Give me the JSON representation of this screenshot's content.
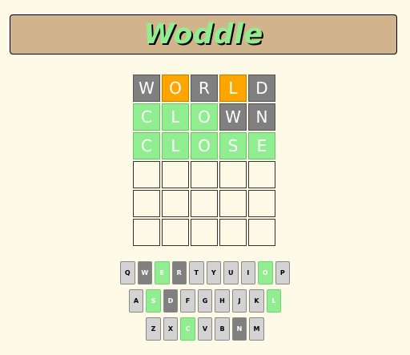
{
  "header": {
    "title": "Woddle"
  },
  "board": {
    "rows": [
      [
        {
          "letter": "W",
          "state": "absent"
        },
        {
          "letter": "O",
          "state": "present"
        },
        {
          "letter": "R",
          "state": "absent"
        },
        {
          "letter": "L",
          "state": "present"
        },
        {
          "letter": "D",
          "state": "absent"
        }
      ],
      [
        {
          "letter": "C",
          "state": "correct"
        },
        {
          "letter": "L",
          "state": "correct"
        },
        {
          "letter": "O",
          "state": "correct"
        },
        {
          "letter": "W",
          "state": "absent"
        },
        {
          "letter": "N",
          "state": "absent"
        }
      ],
      [
        {
          "letter": "C",
          "state": "correct"
        },
        {
          "letter": "L",
          "state": "correct"
        },
        {
          "letter": "O",
          "state": "correct"
        },
        {
          "letter": "S",
          "state": "correct"
        },
        {
          "letter": "E",
          "state": "correct"
        }
      ],
      [
        {
          "letter": "",
          "state": "empty"
        },
        {
          "letter": "",
          "state": "empty"
        },
        {
          "letter": "",
          "state": "empty"
        },
        {
          "letter": "",
          "state": "empty"
        },
        {
          "letter": "",
          "state": "empty"
        }
      ],
      [
        {
          "letter": "",
          "state": "empty"
        },
        {
          "letter": "",
          "state": "empty"
        },
        {
          "letter": "",
          "state": "empty"
        },
        {
          "letter": "",
          "state": "empty"
        },
        {
          "letter": "",
          "state": "empty"
        }
      ],
      [
        {
          "letter": "",
          "state": "empty"
        },
        {
          "letter": "",
          "state": "empty"
        },
        {
          "letter": "",
          "state": "empty"
        },
        {
          "letter": "",
          "state": "empty"
        },
        {
          "letter": "",
          "state": "empty"
        }
      ]
    ]
  },
  "keyboard": {
    "rows": [
      [
        {
          "key": "Q",
          "state": "unused"
        },
        {
          "key": "W",
          "state": "absent"
        },
        {
          "key": "E",
          "state": "correct"
        },
        {
          "key": "R",
          "state": "absent"
        },
        {
          "key": "T",
          "state": "unused"
        },
        {
          "key": "Y",
          "state": "unused"
        },
        {
          "key": "U",
          "state": "unused"
        },
        {
          "key": "I",
          "state": "unused"
        },
        {
          "key": "O",
          "state": "correct"
        },
        {
          "key": "P",
          "state": "unused"
        }
      ],
      [
        {
          "key": "A",
          "state": "unused"
        },
        {
          "key": "S",
          "state": "correct"
        },
        {
          "key": "D",
          "state": "absent"
        },
        {
          "key": "F",
          "state": "unused"
        },
        {
          "key": "G",
          "state": "unused"
        },
        {
          "key": "H",
          "state": "unused"
        },
        {
          "key": "J",
          "state": "unused"
        },
        {
          "key": "K",
          "state": "unused"
        },
        {
          "key": "L",
          "state": "correct"
        }
      ],
      [
        {
          "key": "Z",
          "state": "unused"
        },
        {
          "key": "X",
          "state": "unused"
        },
        {
          "key": "C",
          "state": "correct"
        },
        {
          "key": "V",
          "state": "unused"
        },
        {
          "key": "B",
          "state": "unused"
        },
        {
          "key": "N",
          "state": "absent"
        },
        {
          "key": "M",
          "state": "unused"
        }
      ]
    ]
  },
  "colors": {
    "background": "#fefae8",
    "header": "#d2b48c",
    "title": "#90ee90",
    "absent": "#808080",
    "present": "#ffa500",
    "correct": "#90ee90",
    "unused_key": "#d3d3d3"
  }
}
